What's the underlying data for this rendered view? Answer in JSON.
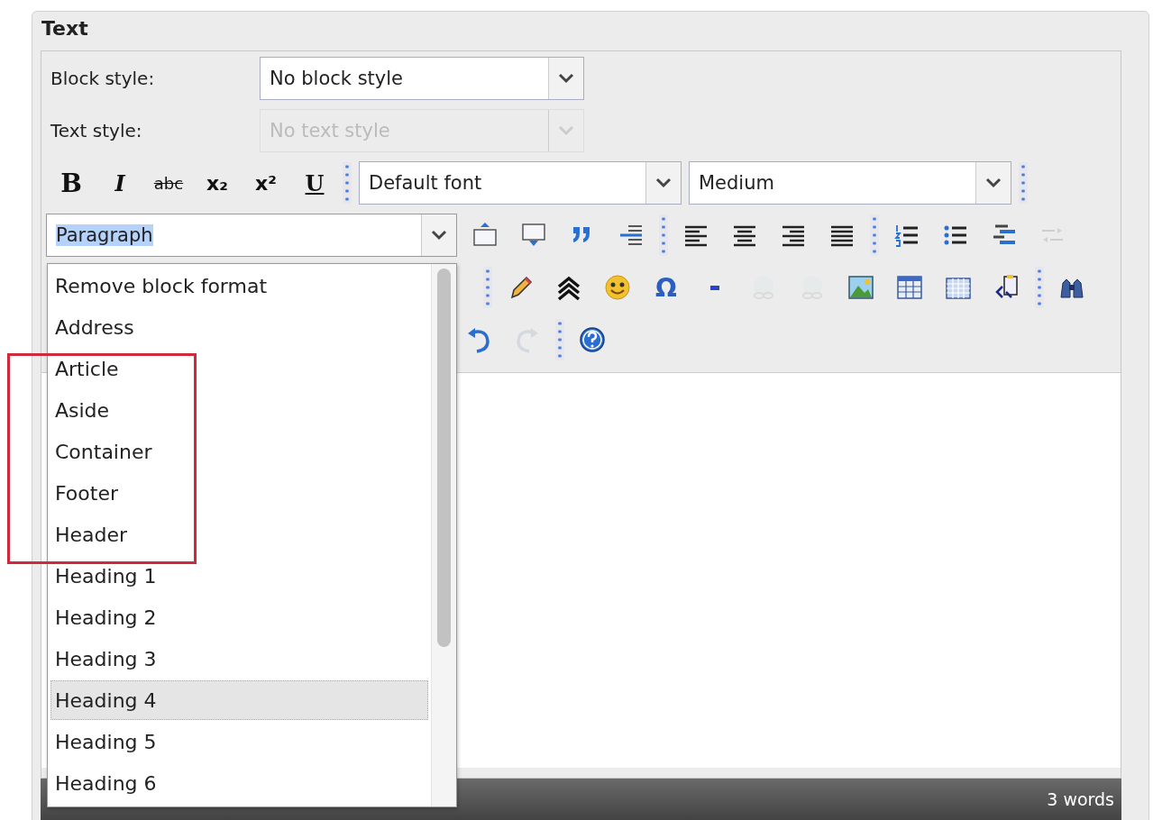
{
  "panel": {
    "title": "Text"
  },
  "block_style": {
    "label": "Block style:",
    "value": "No block style",
    "disabled": false
  },
  "text_style": {
    "label": "Text style:",
    "value": "No text style",
    "disabled": true
  },
  "toolbar": {
    "rows": [
      [
        {
          "kind": "bold",
          "label": "B",
          "disabled": false
        },
        {
          "kind": "italic",
          "label": "I",
          "disabled": false
        },
        {
          "kind": "strikethrough",
          "label": "abc",
          "disabled": false
        },
        {
          "kind": "subscript",
          "label": "x₂",
          "disabled": false
        },
        {
          "kind": "superscript",
          "label": "x²",
          "disabled": false
        },
        {
          "kind": "underline",
          "label": "U",
          "disabled": false
        },
        {
          "kind": "separator"
        },
        {
          "kind": "select",
          "value": "Default font"
        },
        {
          "kind": "select",
          "value": "Medium"
        },
        {
          "kind": "separator"
        }
      ],
      [
        {
          "kind": "format",
          "value": "Paragraph"
        },
        {
          "kind": "insert-above",
          "disabled": false
        },
        {
          "kind": "insert-below",
          "disabled": false
        },
        {
          "kind": "quote",
          "disabled": false
        },
        {
          "kind": "definition-list",
          "disabled": false
        },
        {
          "kind": "separator"
        },
        {
          "kind": "align-left",
          "disabled": false
        },
        {
          "kind": "align-center",
          "disabled": false
        },
        {
          "kind": "align-right",
          "disabled": false
        },
        {
          "kind": "justify",
          "disabled": false
        },
        {
          "kind": "separator"
        },
        {
          "kind": "numbered-list",
          "disabled": false
        },
        {
          "kind": "bullet-list",
          "disabled": false
        },
        {
          "kind": "indent",
          "disabled": false
        },
        {
          "kind": "outdent",
          "disabled": true
        }
      ],
      [
        {
          "kind": "separator"
        },
        {
          "kind": "pencil",
          "disabled": false
        },
        {
          "kind": "chevrons",
          "disabled": false
        },
        {
          "kind": "smiley",
          "disabled": false
        },
        {
          "kind": "omega",
          "label": "Ω",
          "disabled": false
        },
        {
          "kind": "minus",
          "disabled": false
        },
        {
          "kind": "link",
          "disabled": true
        },
        {
          "kind": "unlink",
          "disabled": true
        },
        {
          "kind": "image",
          "disabled": false
        },
        {
          "kind": "table",
          "disabled": false
        },
        {
          "kind": "table-grid",
          "disabled": false
        },
        {
          "kind": "code-paste",
          "disabled": false
        },
        {
          "kind": "separator"
        },
        {
          "kind": "binoculars",
          "disabled": false
        }
      ],
      [
        {
          "kind": "undo",
          "disabled": false
        },
        {
          "kind": "redo",
          "disabled": true
        },
        {
          "kind": "separator"
        },
        {
          "kind": "help",
          "disabled": false
        }
      ]
    ]
  },
  "format_menu": {
    "items": [
      {
        "label": "Remove block format",
        "selected": false
      },
      {
        "label": "Address",
        "selected": false
      },
      {
        "label": "Article",
        "selected": false
      },
      {
        "label": "Aside",
        "selected": false
      },
      {
        "label": "Container",
        "selected": false
      },
      {
        "label": "Footer",
        "selected": false
      },
      {
        "label": "Header",
        "selected": false
      },
      {
        "label": "Heading 1",
        "selected": false
      },
      {
        "label": "Heading 2",
        "selected": false
      },
      {
        "label": "Heading 3",
        "selected": false
      },
      {
        "label": "Heading 4",
        "selected": true
      },
      {
        "label": "Heading 5",
        "selected": false
      },
      {
        "label": "Heading 6",
        "selected": false
      }
    ]
  },
  "status_bar": {
    "word_count": "3 words"
  }
}
